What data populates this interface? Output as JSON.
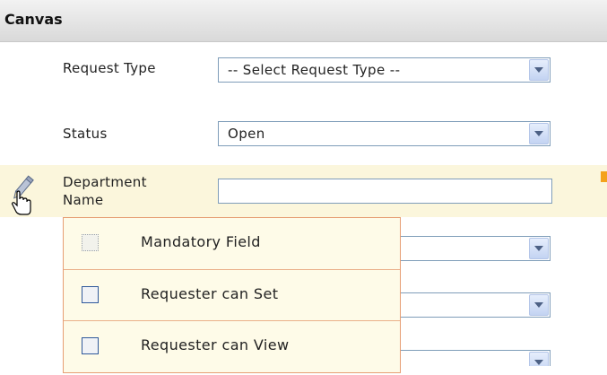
{
  "header": {
    "title": "Canvas"
  },
  "fields": {
    "request_type": {
      "label": "Request Type",
      "value": "-- Select Request Type --"
    },
    "status": {
      "label": "Status",
      "value": "Open"
    },
    "department": {
      "label_line1": "Department",
      "label_line2": "Name",
      "value": ""
    }
  },
  "popup": {
    "items": [
      {
        "label": "Mandatory Field",
        "checked": false,
        "disabled": true
      },
      {
        "label": "Requester can Set",
        "checked": false,
        "disabled": false
      },
      {
        "label": "Requester can View",
        "checked": false,
        "disabled": false
      }
    ]
  },
  "colors": {
    "highlight_row": "#fbf6dc",
    "popup_border": "#e69e74",
    "marker": "#f4a21c"
  },
  "icons": [
    "pencil-edit-icon",
    "hand-cursor-icon",
    "chevron-down-icon"
  ]
}
